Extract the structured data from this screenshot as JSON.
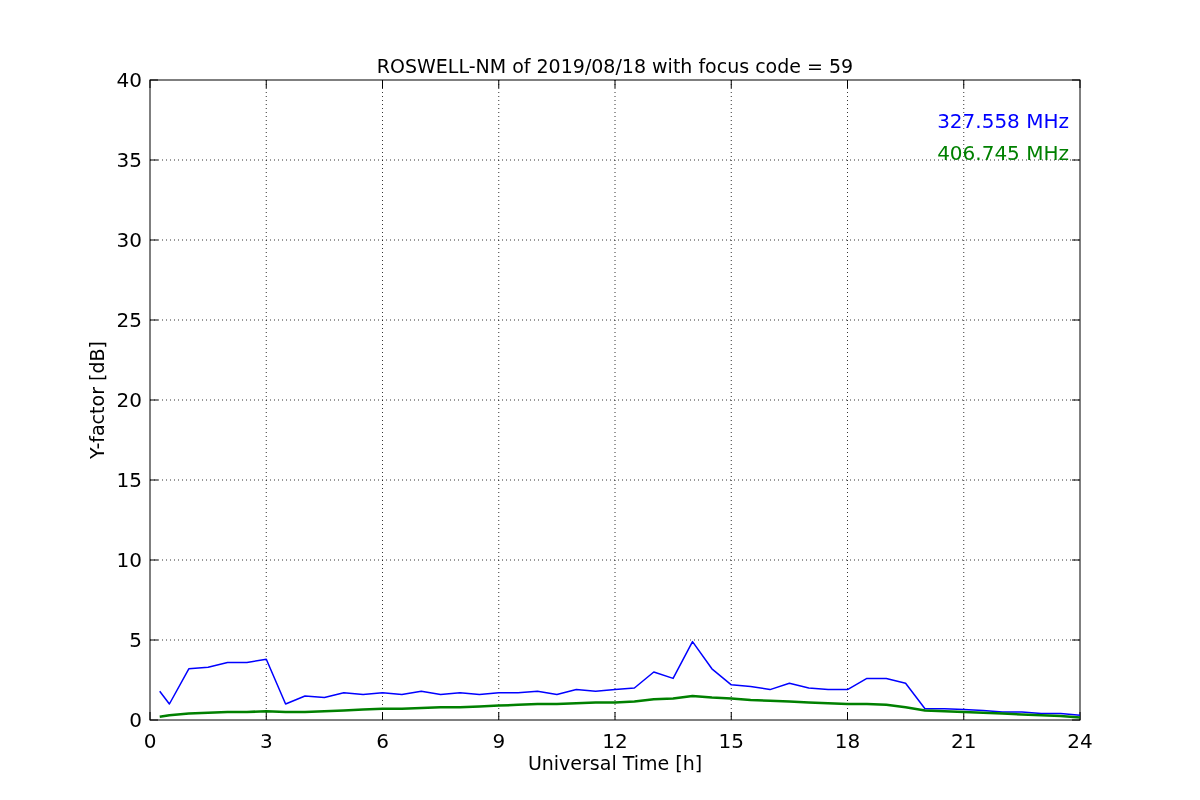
{
  "chart_data": {
    "type": "line",
    "title": "ROSWELL-NM of 2019/08/18 with focus code = 59",
    "xlabel": "Universal Time [h]",
    "ylabel": "Y-factor [dB]",
    "x": [
      0.25,
      0.5,
      1,
      1.5,
      2,
      2.5,
      3,
      3.5,
      4,
      4.5,
      5,
      5.5,
      6,
      6.5,
      7,
      7.5,
      8,
      8.5,
      9,
      9.5,
      10,
      10.5,
      11,
      11.5,
      12,
      12.5,
      13,
      13.5,
      14,
      14.5,
      15,
      15.5,
      16,
      16.5,
      17,
      17.5,
      18,
      18.5,
      19,
      19.5,
      20,
      20.5,
      21,
      21.5,
      22,
      22.5,
      23,
      23.5,
      24
    ],
    "series": [
      {
        "name": "327.558 MHz",
        "color": "#0000ff",
        "values": [
          1.8,
          1.0,
          3.2,
          3.3,
          3.6,
          3.6,
          3.8,
          1.0,
          1.5,
          1.4,
          1.7,
          1.6,
          1.7,
          1.6,
          1.8,
          1.6,
          1.7,
          1.6,
          1.7,
          1.7,
          1.8,
          1.6,
          1.9,
          1.8,
          1.9,
          2.0,
          3.0,
          2.6,
          4.9,
          3.2,
          2.2,
          2.1,
          1.9,
          2.3,
          2.0,
          1.9,
          1.9,
          2.6,
          2.6,
          2.3,
          0.7,
          0.7,
          0.65,
          0.6,
          0.5,
          0.5,
          0.4,
          0.4,
          0.3
        ]
      },
      {
        "name": "406.745 MHz",
        "color": "#008000",
        "values": [
          0.2,
          0.3,
          0.4,
          0.45,
          0.5,
          0.5,
          0.55,
          0.5,
          0.5,
          0.55,
          0.6,
          0.65,
          0.7,
          0.7,
          0.75,
          0.8,
          0.8,
          0.85,
          0.9,
          0.95,
          1.0,
          1.0,
          1.05,
          1.1,
          1.1,
          1.15,
          1.3,
          1.35,
          1.5,
          1.4,
          1.35,
          1.25,
          1.2,
          1.15,
          1.1,
          1.05,
          1.0,
          1.0,
          0.95,
          0.8,
          0.6,
          0.55,
          0.5,
          0.45,
          0.4,
          0.35,
          0.3,
          0.25,
          0.15
        ]
      }
    ],
    "xlim": [
      0,
      24
    ],
    "ylim": [
      0,
      40
    ],
    "xticks": [
      0,
      3,
      6,
      9,
      12,
      15,
      18,
      21,
      24
    ],
    "yticks": [
      0,
      5,
      10,
      15,
      20,
      25,
      30,
      35,
      40
    ],
    "grid": true
  }
}
